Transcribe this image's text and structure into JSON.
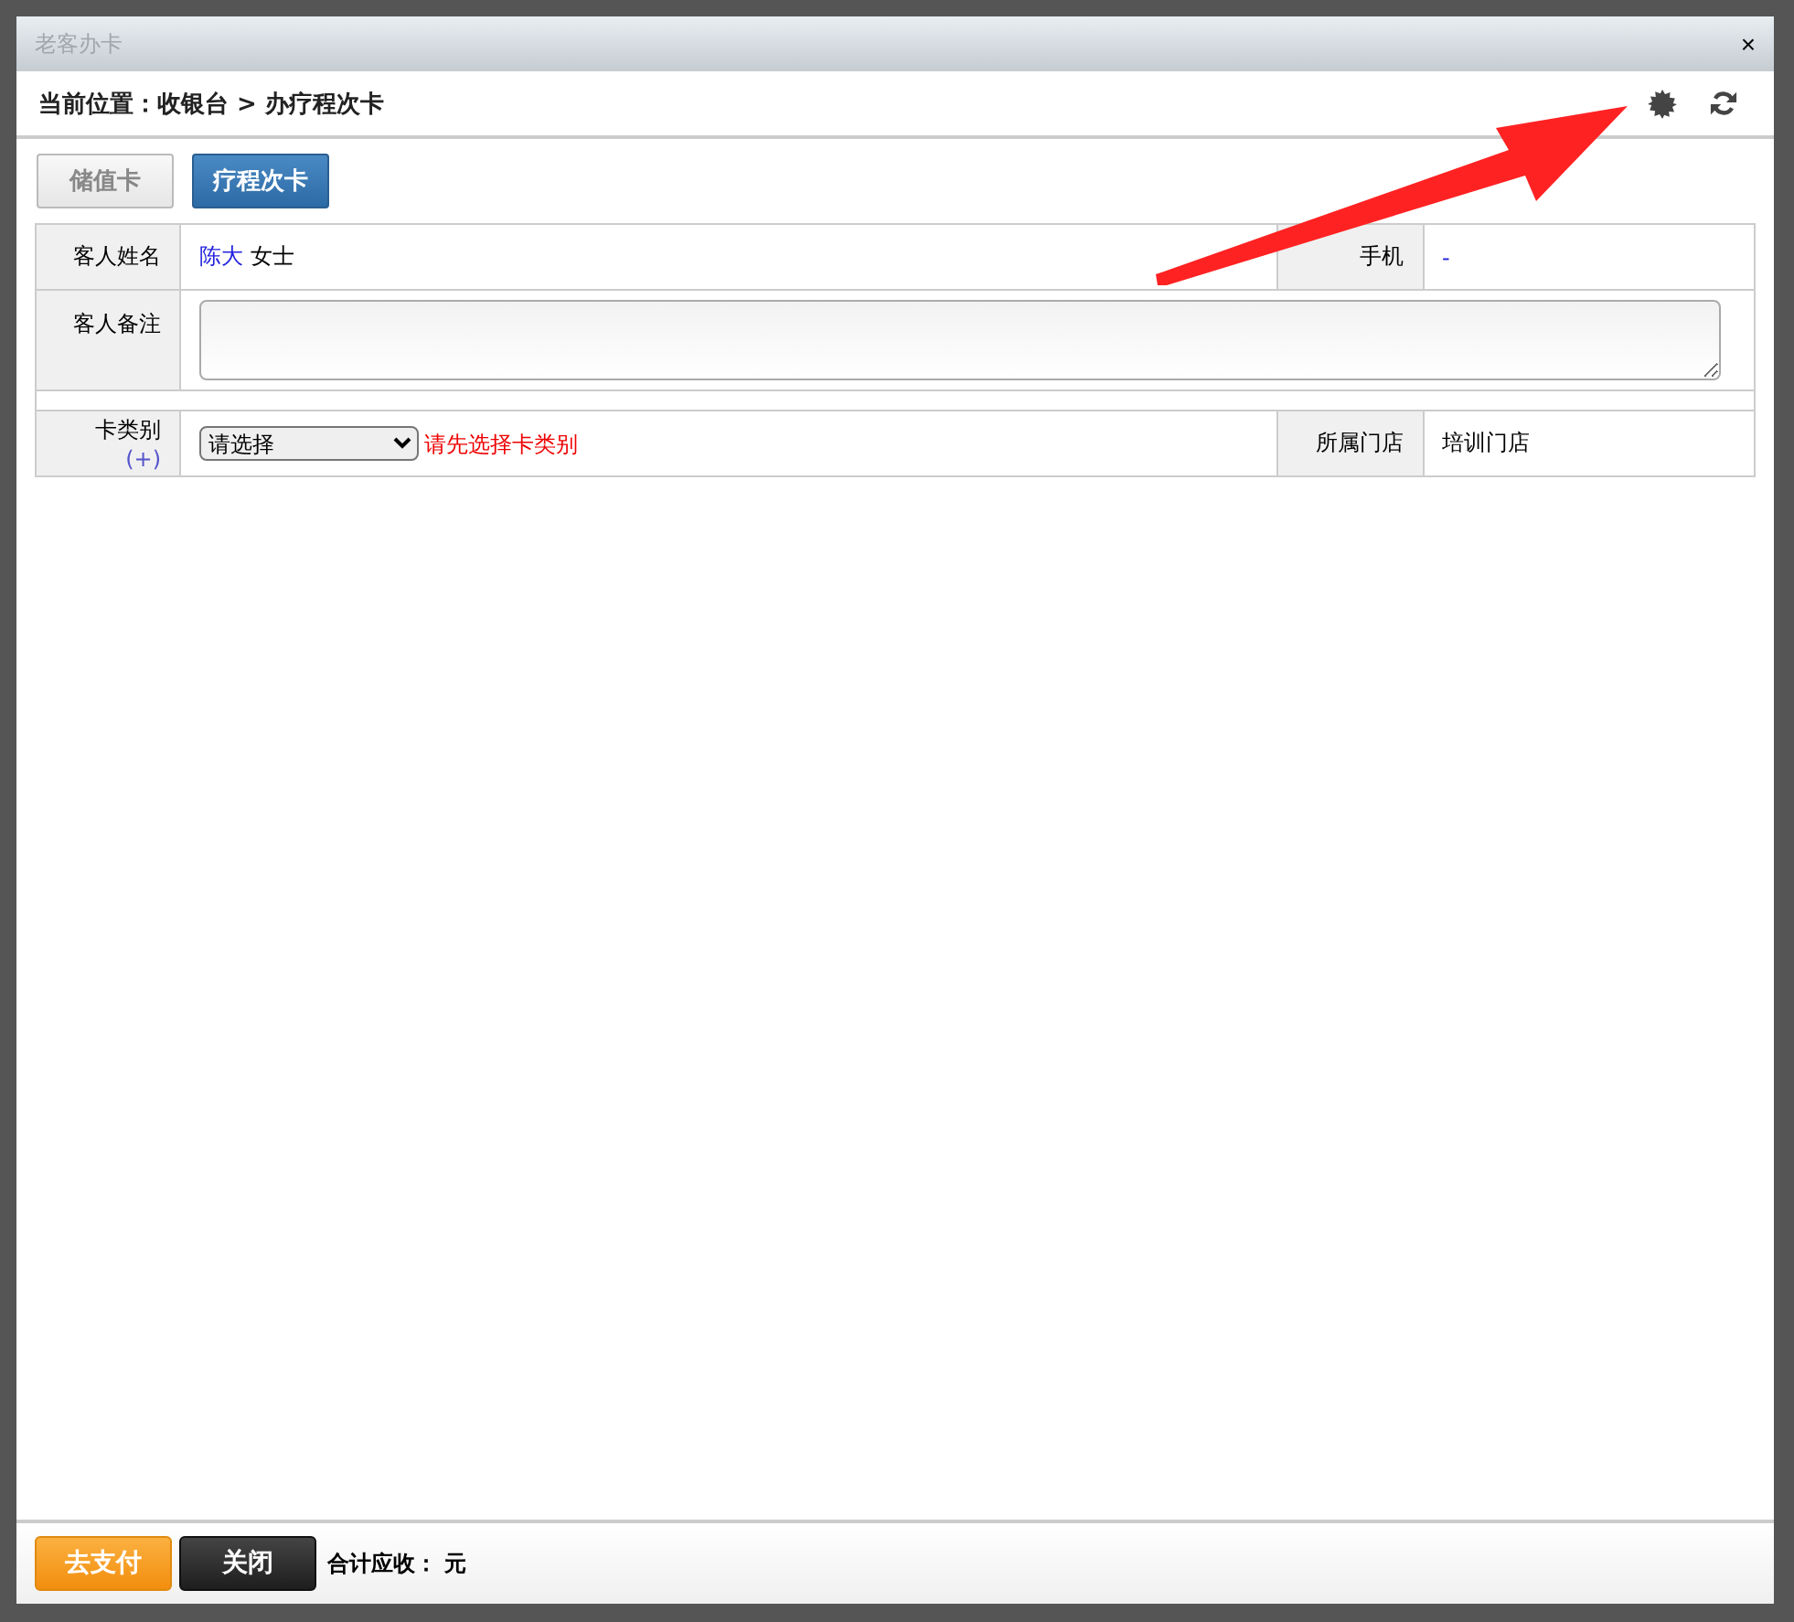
{
  "window": {
    "title": "老客办卡",
    "close": "×"
  },
  "breadcrumb": {
    "label": "当前位置：",
    "path": "收银台 > 办疗程次卡"
  },
  "tabs": [
    {
      "label": "储值卡",
      "selected": false
    },
    {
      "label": "疗程次卡",
      "selected": true
    }
  ],
  "form": {
    "name_label": "客人姓名",
    "name": "陈大",
    "title": "女士",
    "phone_label": "手机",
    "phone": "-",
    "note_label": "客人备注",
    "card_type_label": "卡类别",
    "add_link": "(+)",
    "card_type_select": "请选择",
    "card_type_error": "请先选择卡类别",
    "store_label": "所属门店",
    "store": "培训门店"
  },
  "footer": {
    "pay_button": "去支付",
    "close_button": "关闭",
    "total_label": "合计应收：",
    "total_unit": "元"
  }
}
